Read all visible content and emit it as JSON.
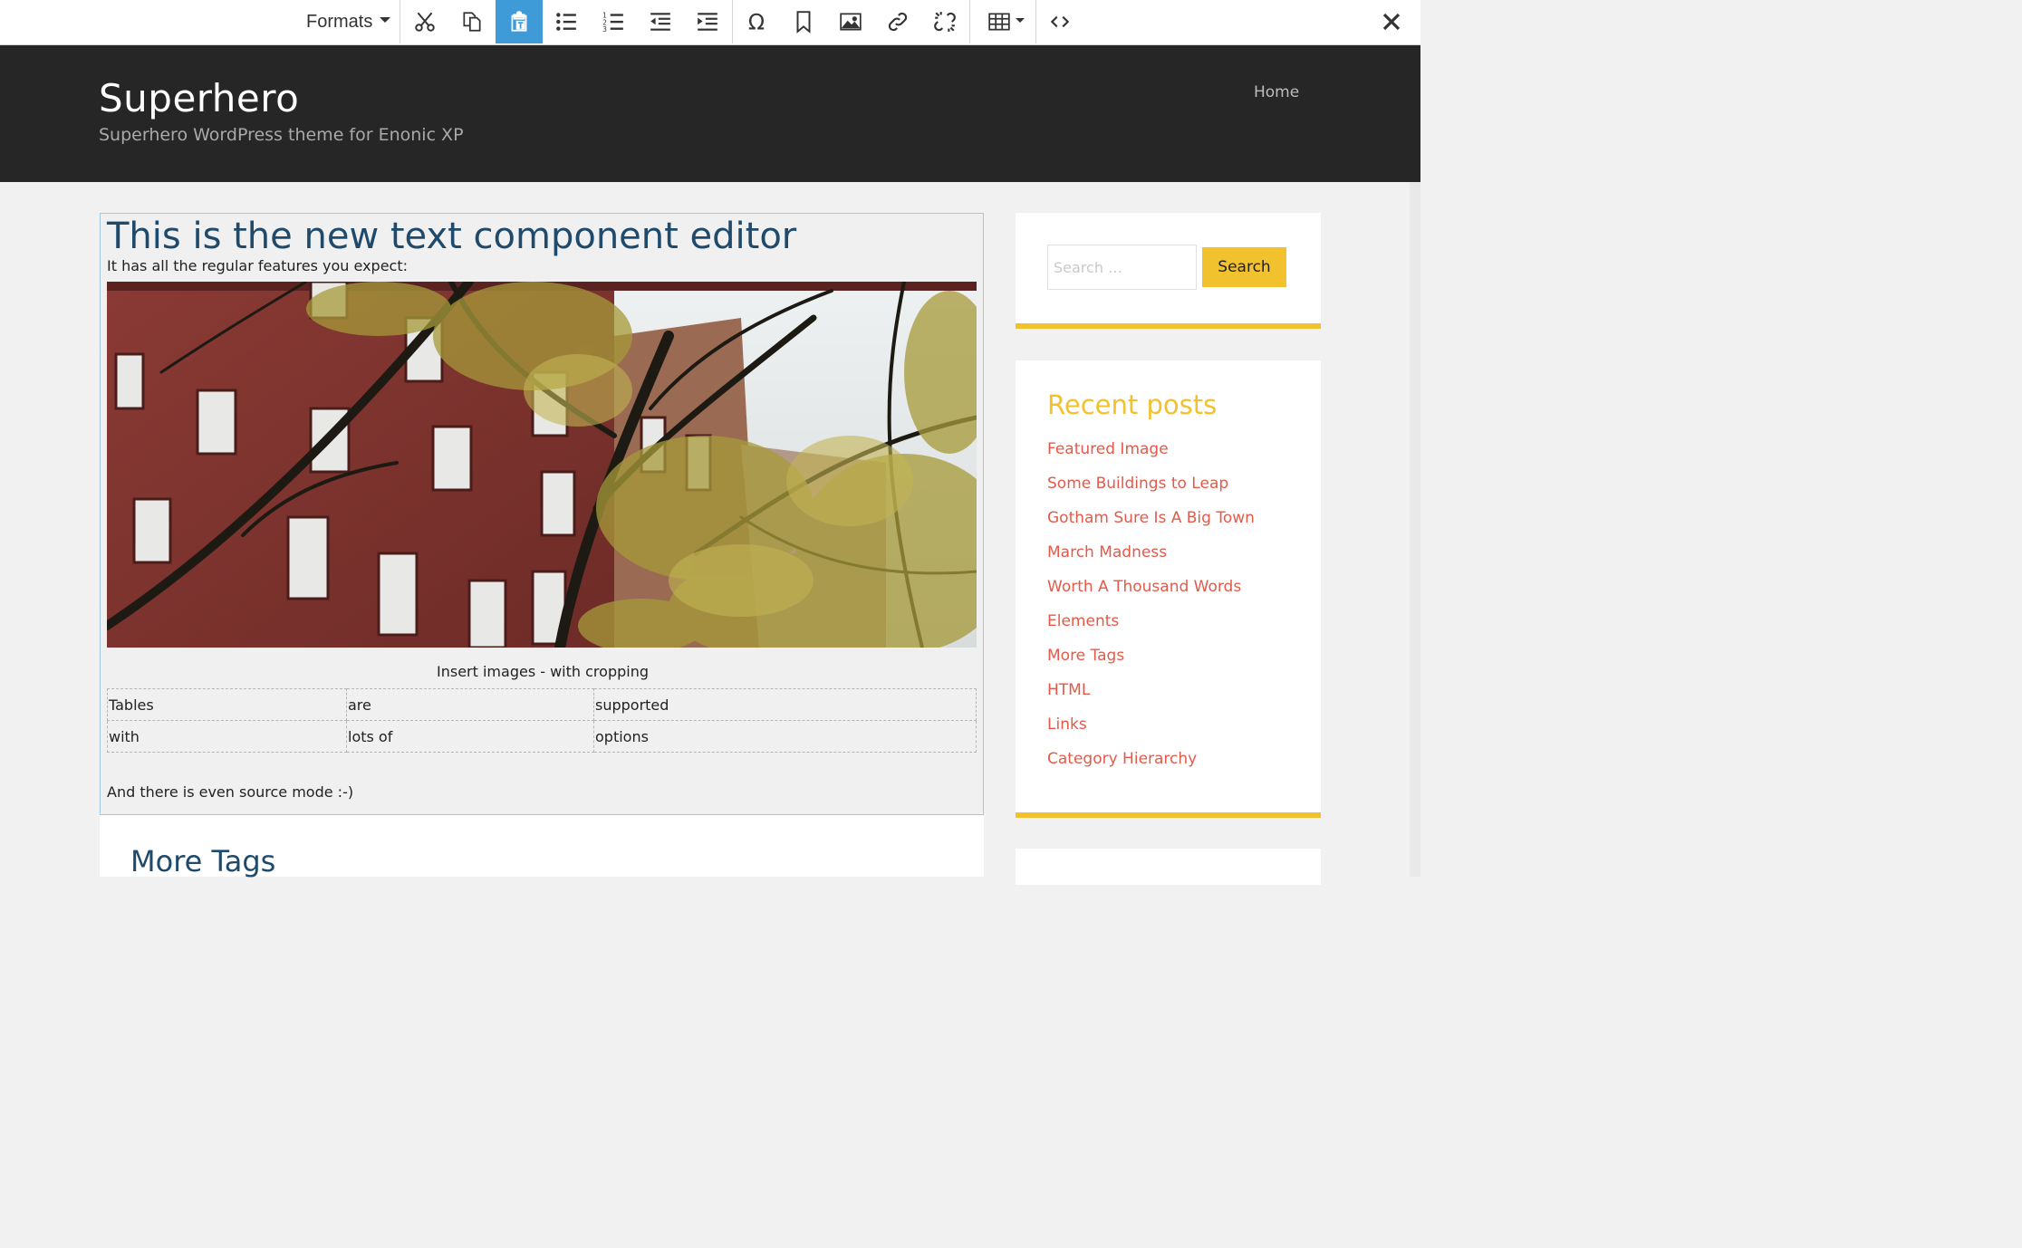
{
  "toolbar": {
    "formats_label": "Formats",
    "buttons": [
      "cut-icon",
      "copy-icon",
      "paste-text-icon",
      "bullet-list-icon",
      "numbered-list-icon",
      "outdent-icon",
      "indent-icon",
      "special-char-icon",
      "anchor-icon",
      "image-icon",
      "link-icon",
      "unlink-icon",
      "table-icon",
      "source-code-icon"
    ],
    "active_button": "paste-text-icon",
    "close_icon": "close-icon",
    "active_color": "#3f9ad8"
  },
  "header": {
    "title": "Superhero",
    "description": "Superhero WordPress theme for Enonic XP",
    "nav": [
      "Home"
    ]
  },
  "editor": {
    "heading": "This is the new text component editor",
    "intro": "It has all the regular features you expect:",
    "caption": "Insert images - with cropping",
    "table": [
      [
        "Tables",
        "are",
        "supported"
      ],
      [
        "with",
        "lots of",
        "options"
      ]
    ],
    "footer_text": "And there is even source mode :-)"
  },
  "next_post": {
    "title": "More Tags"
  },
  "sidebar": {
    "search_placeholder": "Search …",
    "search_button": "Search",
    "recent_title": "Recent posts",
    "recent_posts": [
      "Featured Image",
      "Some Buildings to Leap",
      "Gotham Sure Is A Big Town",
      "March Madness",
      "Worth A Thousand Words",
      "Elements",
      "More Tags",
      "HTML",
      "Links",
      "Category Hierarchy"
    ],
    "accent_color": "#f2c12e",
    "link_color": "#e35a4a"
  }
}
